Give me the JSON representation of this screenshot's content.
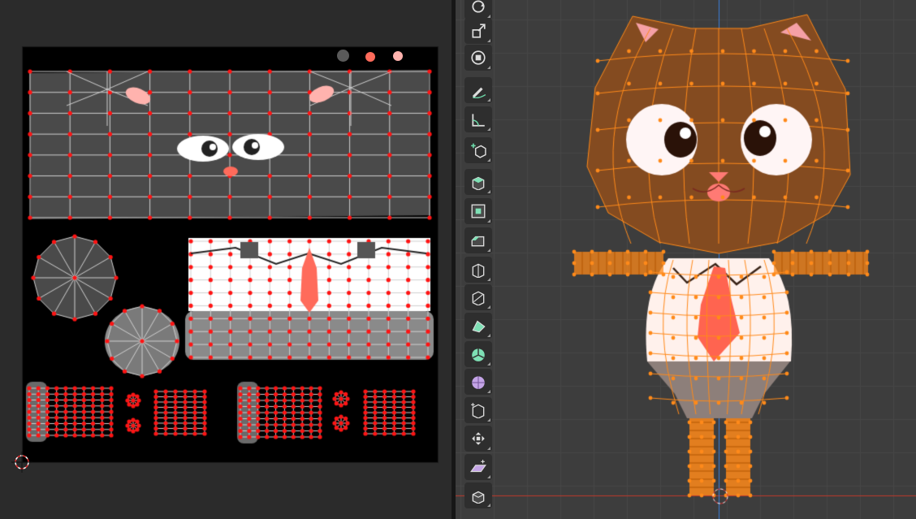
{
  "uv_editor": {
    "image_bg": "#000000",
    "vertex_color": "#ff1414",
    "edge_color": "#d0d0d0",
    "palette": [
      "#5a5a5a",
      "#ff6b5b",
      "#ffb3ae"
    ],
    "cursor_icon": "2d-cursor-icon"
  },
  "viewport": {
    "grid_bg": "#3d3d3d",
    "selection_color": "#ff8a1a",
    "x_axis_color": "#c0392b",
    "z_axis_color": "#3c7dd9",
    "character_colors": {
      "fur": "#5b3622",
      "inner_ear": "#f5a0a6",
      "eye_white": "#fff5f5",
      "pupil": "#2a1208",
      "nose": "#ff7a74",
      "shirt": "#fff1ec",
      "tie": "#ff6450",
      "collar_outline": "#3a2418",
      "pants": "#8d7f7a"
    }
  },
  "toolbar": {
    "tools": [
      {
        "name": "rotate-tool-icon",
        "active": false
      },
      {
        "name": "scale-tool-icon",
        "active": false
      },
      {
        "name": "transform-tool-icon",
        "active": false
      },
      {
        "name": "annotate-tool-icon",
        "active": false
      },
      {
        "name": "measure-tool-icon",
        "active": false
      },
      {
        "name": "add-cube-tool-icon",
        "active": false
      },
      {
        "name": "extrude-region-tool-icon",
        "active": false
      },
      {
        "name": "inset-faces-tool-icon",
        "active": false
      },
      {
        "name": "bevel-tool-icon",
        "active": false
      },
      {
        "name": "loop-cut-tool-icon",
        "active": false
      },
      {
        "name": "knife-tool-icon",
        "active": false
      },
      {
        "name": "poly-build-tool-icon",
        "active": false
      },
      {
        "name": "spin-tool-icon",
        "active": false
      },
      {
        "name": "smooth-tool-icon",
        "active": false
      },
      {
        "name": "edge-slide-tool-icon",
        "active": false
      },
      {
        "name": "shrink-fatten-tool-icon",
        "active": false
      },
      {
        "name": "shear-tool-icon",
        "active": false
      },
      {
        "name": "rip-region-tool-icon",
        "active": false
      }
    ]
  }
}
